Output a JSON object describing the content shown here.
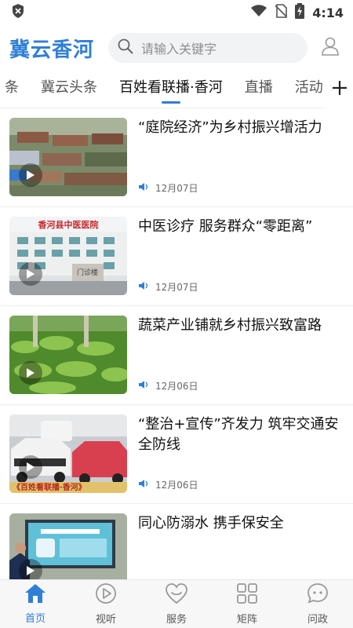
{
  "status_bar": {
    "time": "4:14"
  },
  "header": {
    "logo": "冀云香河",
    "search_placeholder": "请输入关键字"
  },
  "tabs": [
    {
      "label": "条"
    },
    {
      "label": "冀云头条"
    },
    {
      "label": "百姓看联播·香河",
      "active": true
    },
    {
      "label": "直播"
    },
    {
      "label": "活动"
    }
  ],
  "news": [
    {
      "title": "“庭院经济”为乡村振兴增活力",
      "date": "12月07日"
    },
    {
      "title": "中医诊疗 服务群众“零距离”",
      "date": "12月07日"
    },
    {
      "title": "蔬菜产业铺就乡村振兴致富路",
      "date": "12月06日"
    },
    {
      "title": "“整治+宣传”齐发力 筑牢交通安全防线",
      "date": "12月06日"
    },
    {
      "title": "同心防溺水 携手保安全",
      "date": ""
    }
  ],
  "thumb_texts": {
    "news2_banner": "香河县中医医院",
    "news2_sign": "门诊楼",
    "news4_caption": "《百姓看联播·香河》"
  },
  "bottom_nav": [
    {
      "label": "首页",
      "icon": "home-icon",
      "active": true
    },
    {
      "label": "视听",
      "icon": "play-circle-icon"
    },
    {
      "label": "服务",
      "icon": "heart-icon"
    },
    {
      "label": "矩阵",
      "icon": "grid-icon"
    },
    {
      "label": "问政",
      "icon": "chat-icon"
    }
  ],
  "colors": {
    "accent": "#2f7fd6",
    "text": "#111111",
    "muted": "#666666"
  }
}
